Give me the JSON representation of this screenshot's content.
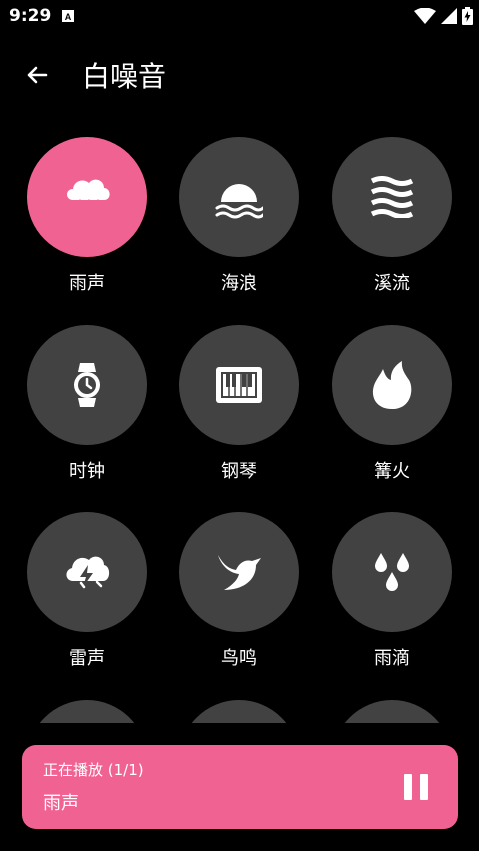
{
  "status_bar": {
    "time": "9:29",
    "icons": [
      "notification-a-icon",
      "wifi-icon",
      "signal-icon",
      "battery-charging-icon"
    ]
  },
  "app_bar": {
    "title": "白噪音",
    "back_icon": "arrow-left-icon"
  },
  "colors": {
    "accent": "#f06292",
    "tile": "#424242",
    "background": "#000000"
  },
  "sounds": [
    {
      "label": "雨声",
      "icon": "rain-cloud-icon",
      "active": true
    },
    {
      "label": "海浪",
      "icon": "wave-sun-icon",
      "active": false
    },
    {
      "label": "溪流",
      "icon": "stream-waves-icon",
      "active": false
    },
    {
      "label": "时钟",
      "icon": "watch-icon",
      "active": false
    },
    {
      "label": "钢琴",
      "icon": "piano-icon",
      "active": false
    },
    {
      "label": "篝火",
      "icon": "fire-icon",
      "active": false
    },
    {
      "label": "雷声",
      "icon": "thunder-cloud-icon",
      "active": false
    },
    {
      "label": "鸟鸣",
      "icon": "bird-icon",
      "active": false
    },
    {
      "label": "雨滴",
      "icon": "raindrops-icon",
      "active": false
    }
  ],
  "now_playing": {
    "status": "正在播放 (1/1)",
    "title": "雨声",
    "control_icon": "pause-icon"
  }
}
